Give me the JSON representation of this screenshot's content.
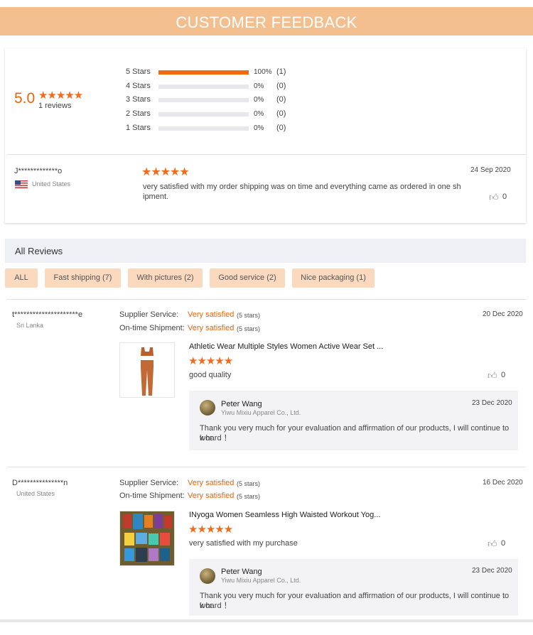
{
  "banner": {
    "title": "CUSTOMER FEEDBACK"
  },
  "summary": {
    "score": "5.0",
    "stars": "★★★★★",
    "reviews_count": "1 reviews",
    "distribution": [
      {
        "label": "5 Stars",
        "fill": 1.0,
        "pct": "100%",
        "count": "(1)"
      },
      {
        "label": "4 Stars",
        "fill": 0,
        "pct": "0%",
        "count": "(0)"
      },
      {
        "label": "3 Stars",
        "fill": 0,
        "pct": "0%",
        "count": "(0)"
      },
      {
        "label": "2 Stars",
        "fill": 0,
        "pct": "0%",
        "count": "(0)"
      },
      {
        "label": "1 Stars",
        "fill": 0,
        "pct": "0%",
        "count": "(0)"
      }
    ],
    "top_review": {
      "user": "J*************o",
      "country": "United States",
      "stars": "★★★★★",
      "text_line1": "very satisfied with my order shipping was on time and everything came as ordered in one sh",
      "text_line2": "ipment.",
      "date": "24 Sep 2020",
      "likes": "0"
    }
  },
  "all_reviews": {
    "title": "All Reviews",
    "filters": [
      "ALL",
      "Fast shipping (7)",
      "With pictures (2)",
      "Good service (2)",
      "Nice packaging (1)"
    ],
    "supplier_label": "Supplier Service:",
    "shipment_label": "On-time Shipment:",
    "reviews": [
      {
        "user": "t*********************e",
        "country": "Sri Lanka",
        "supplier_rating": "Very satisfied",
        "supplier_stars": "(5 stars)",
        "shipment_rating": "Very satisfied",
        "shipment_stars": "(5 stars)",
        "date": "20 Dec 2020",
        "product": "Athletic Wear Multiple Styles Women Active Wear Set ...",
        "stars": "★★★★★",
        "text": "good quality",
        "likes": "0",
        "reply": {
          "name": "Peter Wang",
          "company": "Yiwu Mixiu Apparel Co., Ltd.",
          "date": "23 Dec 2020",
          "line1": "Thank you very much for your evaluation and affirmation of our products, I will continue to wor",
          "line2": "k hard ！"
        }
      },
      {
        "user": "D***************n",
        "country": "United States",
        "supplier_rating": "Very satisfied",
        "supplier_stars": "(5 stars)",
        "shipment_rating": "Very satisfied",
        "shipment_stars": "(5 stars)",
        "date": "16 Dec 2020",
        "product": "INyoga Women Seamless High Waisted Workout Yog...",
        "stars": "★★★★★",
        "text": "very satisfied with my purchase",
        "likes": "0",
        "reply": {
          "name": "Peter Wang",
          "company": "Yiwu Mixiu Apparel Co., Ltd.",
          "date": "23 Dec 2020",
          "line1": "Thank you very much for your evaluation and affirmation of our products, I will continue to wor",
          "line2": "k hard ！"
        }
      }
    ]
  }
}
